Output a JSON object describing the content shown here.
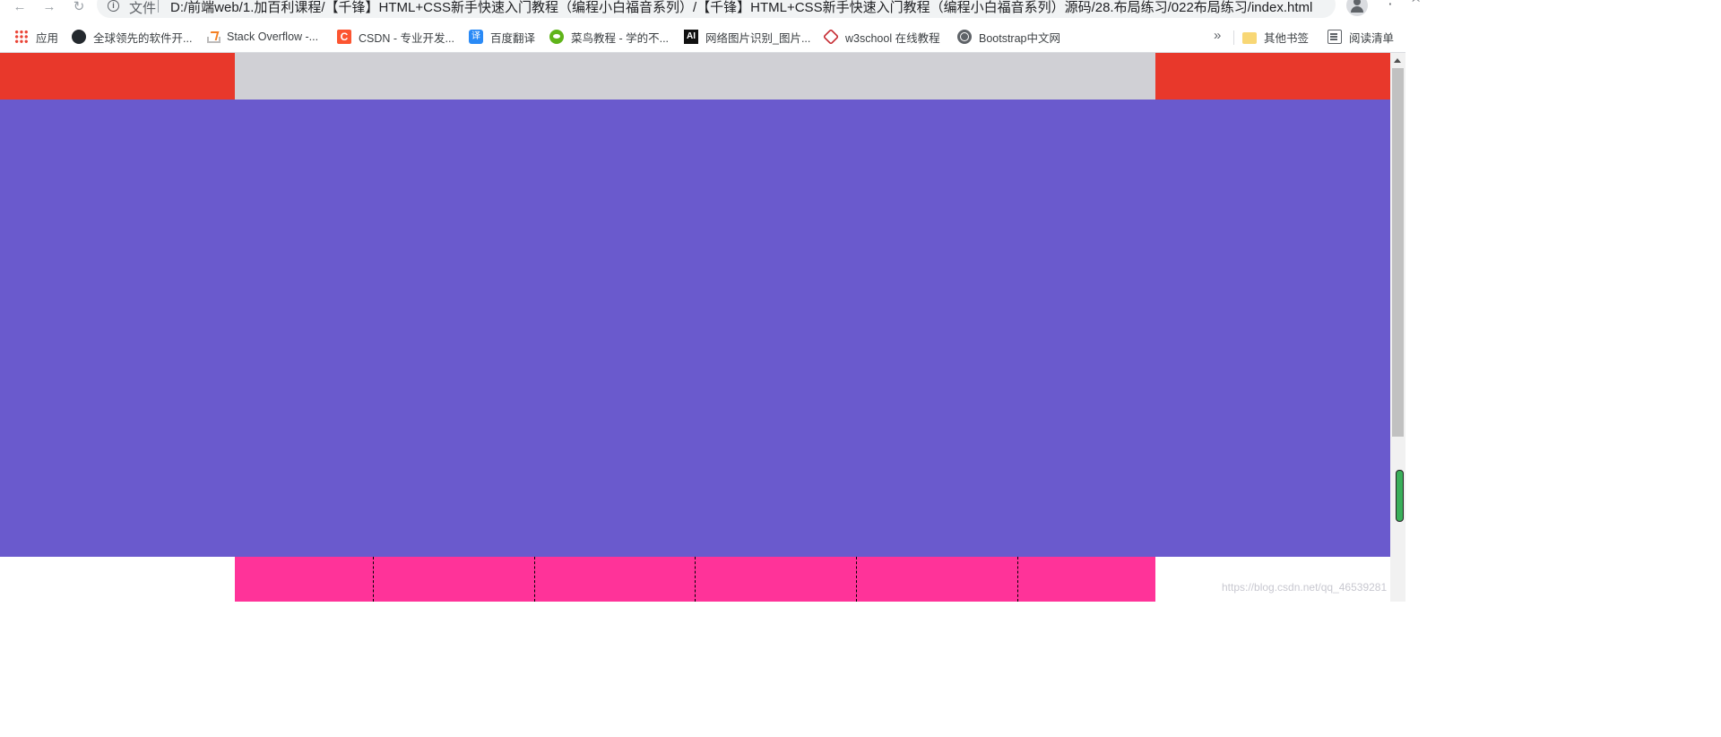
{
  "browser": {
    "back_icon": "←",
    "forward_icon": "→",
    "reload_icon": "↻",
    "scheme_label": "文件",
    "url": "D:/前端web/1.加百利课程/【千锋】HTML+CSS新手快速入门教程（编程小白福音系列）/【千锋】HTML+CSS新手快速入门教程（编程小白福音系列）源码/28.布局练习/022布局练习/index.html",
    "star_icon": "☆",
    "menu_icon": "⋮"
  },
  "bookmarks": {
    "items": [
      {
        "label": "应用",
        "icon": "apps-icon"
      },
      {
        "label": "全球领先的软件开...",
        "icon": "github-icon"
      },
      {
        "label": "Stack Overflow -...",
        "icon": "stackoverflow-icon"
      },
      {
        "label": "CSDN - 专业开发...",
        "icon": "csdn-icon"
      },
      {
        "label": "百度翻译",
        "icon": "translate-icon"
      },
      {
        "label": "菜鸟教程 - 学的不...",
        "icon": "runoob-icon"
      },
      {
        "label": "网络图片识别_图片...",
        "icon": "ai-icon"
      },
      {
        "label": "w3school 在线教程",
        "icon": "w3school-icon"
      },
      {
        "label": "Bootstrap中文网",
        "icon": "globe-icon"
      }
    ],
    "more_label": "»",
    "other_bookmarks_label": "其他书签",
    "reading_list_label": "阅读清单",
    "csdn_glyph": "C",
    "translate_glyph": "译",
    "ai_glyph": "AI"
  },
  "page": {
    "colors": {
      "topbar": "#e8382b",
      "topbar_inner": "#d0d0d5",
      "banner": "#6a5acd",
      "nav": "#ff3399"
    },
    "watermark": "https://blog.csdn.net/qq_46539281"
  }
}
